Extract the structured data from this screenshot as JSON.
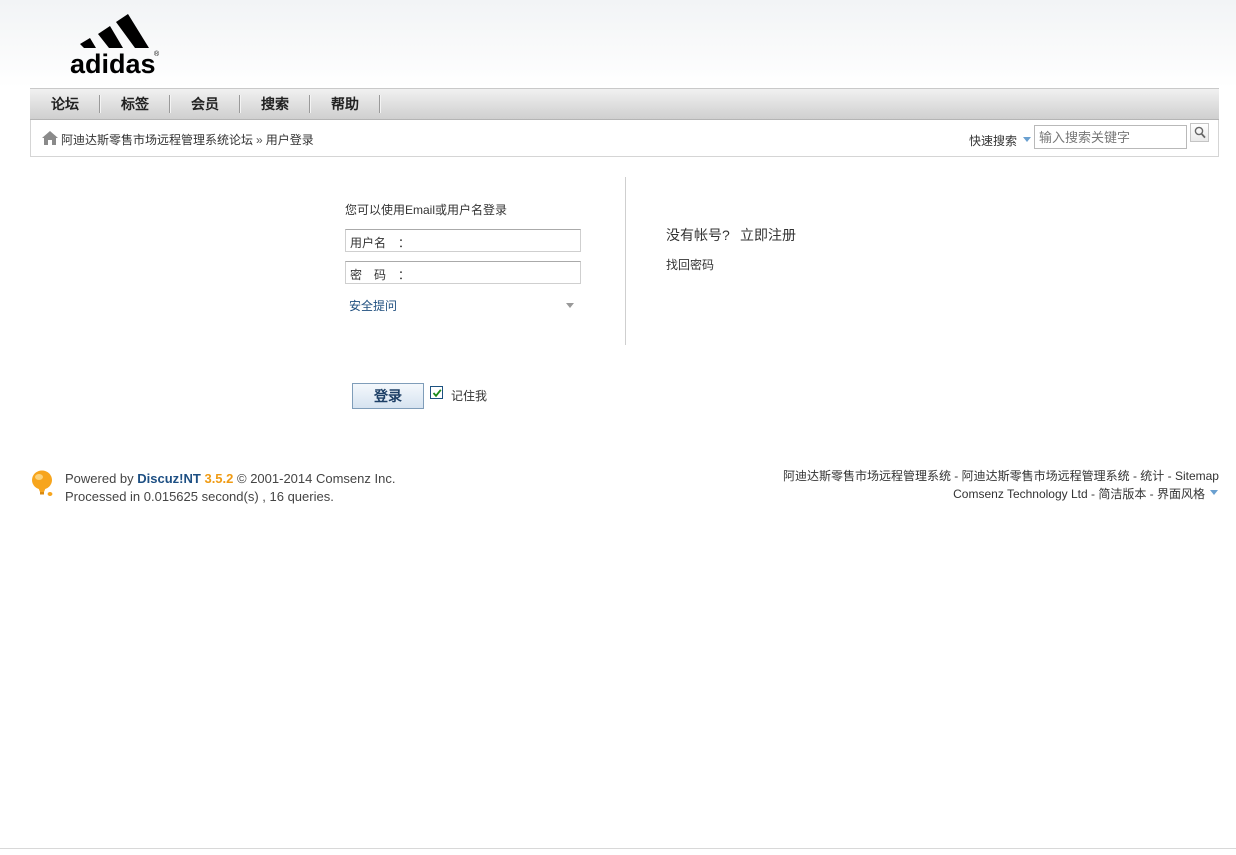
{
  "header": {
    "logo_text": "adidas"
  },
  "nav": {
    "items": [
      "论坛",
      "标签",
      "会员",
      "搜索",
      "帮助"
    ]
  },
  "breadcrumb": {
    "home_label": "阿迪达斯零售市场远程管理系统论坛",
    "separator": "»",
    "current": "用户登录"
  },
  "quick_search": {
    "label": "快速搜索",
    "placeholder": "输入搜索关键字"
  },
  "login": {
    "hint": "您可以使用Email或用户名登录",
    "username_label": "用户名　：",
    "password_label": "密　码　：",
    "security_question": "安全提问",
    "submit_label": "登录",
    "remember_label": "记住我",
    "remember_checked": true
  },
  "side": {
    "no_account": "没有帐号?",
    "register": "立即注册",
    "find_password": "找回密码"
  },
  "footer": {
    "powered_prefix": "Powered by",
    "brand": "Discuz!NT",
    "version": "3.5.2",
    "copyright": "© 2001-2014 Comsenz Inc.",
    "processed": "Processed in 0.015625 second(s) , 16 queries.",
    "right_line1": "阿迪达斯零售市场远程管理系统 - 阿迪达斯零售市场远程管理系统 - 统计 -  Sitemap",
    "right_line2": "Comsenz Technology Ltd - 简洁版本 - 界面风格"
  },
  "colors": {
    "link_blue": "#1d4f83",
    "version_orange": "#f09b13",
    "accent_arrow": "#6aa0d0"
  }
}
